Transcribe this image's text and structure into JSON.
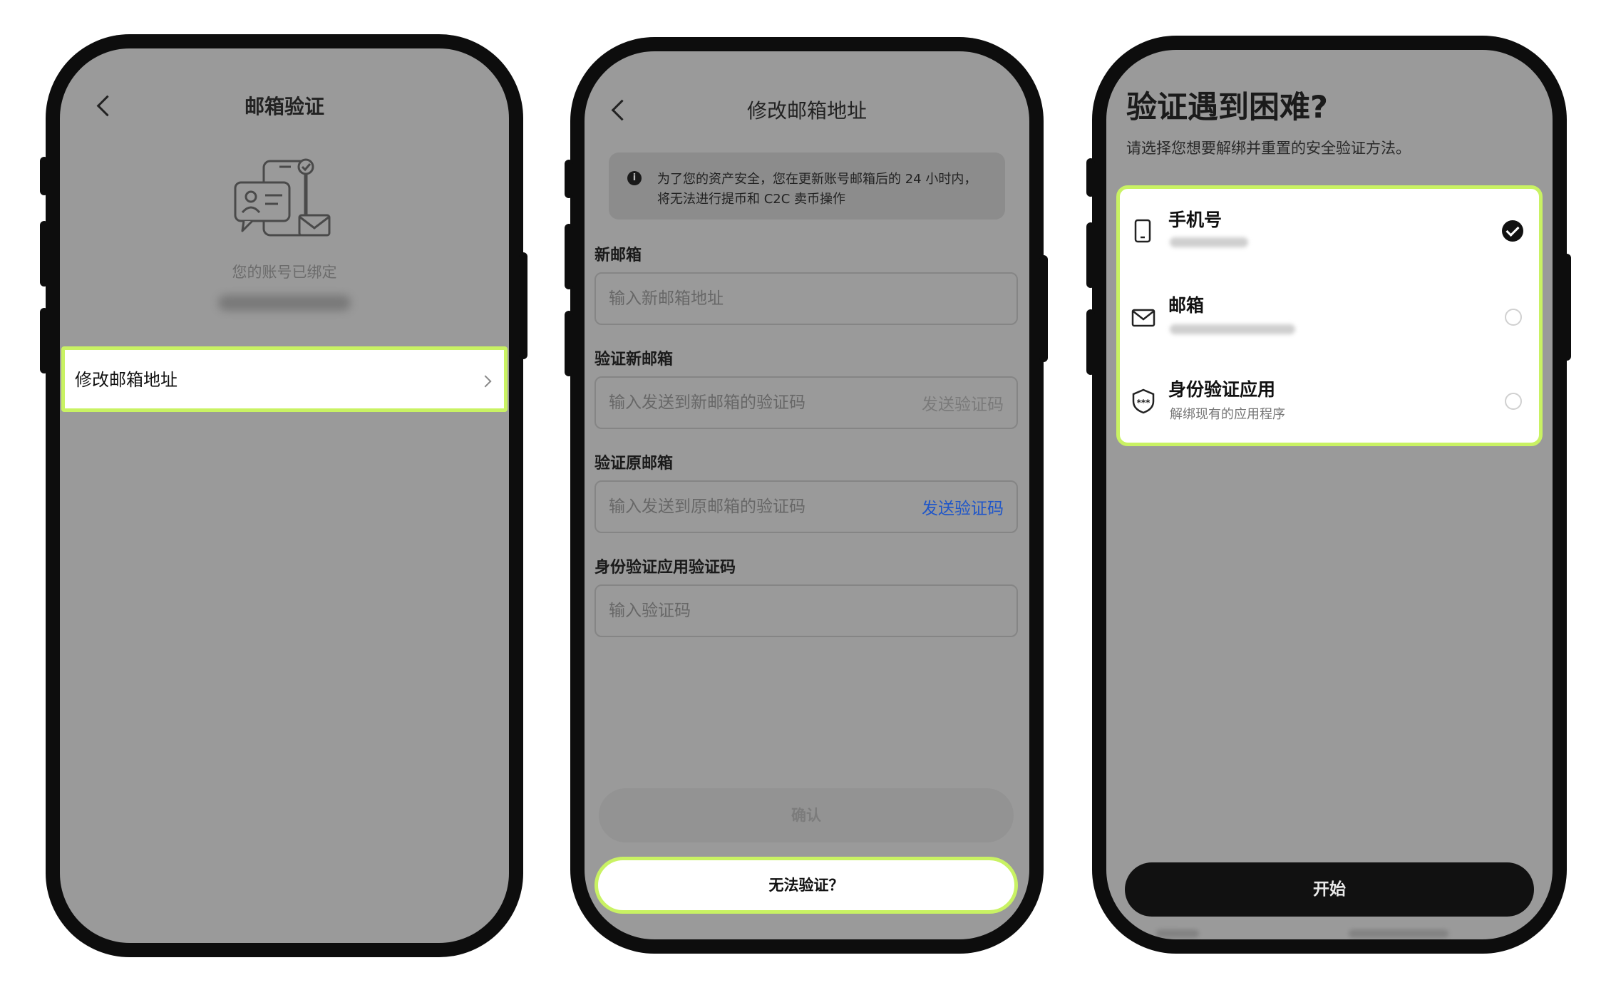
{
  "phone1": {
    "nav_title": "邮箱验证",
    "bound_text": "您的账号已绑定",
    "row_label": "修改邮箱地址"
  },
  "phone2": {
    "nav_title": "修改邮箱地址",
    "notice_line1": "为了您的资产安全，您在更新账号邮箱后的 24 小时内，",
    "notice_line2": "将无法进行提币和 C2C 卖币操作",
    "new_email_label": "新邮箱",
    "new_email_placeholder": "输入新邮箱地址",
    "verify_new_label": "验证新邮箱",
    "verify_new_placeholder": "输入发送到新邮箱的验证码",
    "send_code_disabled": "发送验证码",
    "verify_old_label": "验证原邮箱",
    "verify_old_placeholder": "输入发送到原邮箱的验证码",
    "send_code_active": "发送验证码",
    "auth_label": "身份验证应用验证码",
    "auth_placeholder": "输入验证码",
    "confirm_label": "确认",
    "cant_verify_label": "无法验证？"
  },
  "phone3": {
    "title": "验证遇到困难?",
    "subtitle": "请选择您想要解绑并重置的安全验证方法。",
    "options": [
      {
        "name": "手机号",
        "sub": "",
        "selected": true,
        "icon": "phone-icon"
      },
      {
        "name": "邮箱",
        "sub": "",
        "selected": false,
        "icon": "mail-icon"
      },
      {
        "name": "身份验证应用",
        "sub": "解绑现有的应用程序",
        "selected": false,
        "icon": "shield-icon"
      }
    ],
    "start_label": "开始"
  },
  "colors": {
    "highlight": "#c9f263",
    "link_blue": "#1f56c9",
    "screen_gray": "#9a9a9a",
    "frame": "#0d0d0d"
  }
}
